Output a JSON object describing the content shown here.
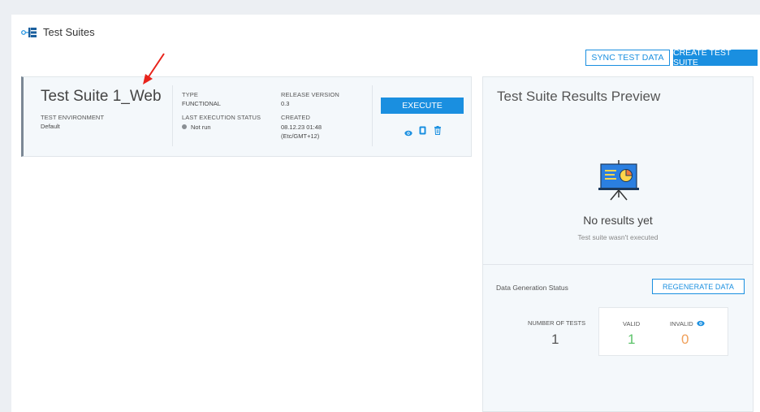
{
  "page": {
    "title": "Test Suites",
    "sync_label": "SYNC TEST DATA",
    "create_label": "CREATE TEST SUITE"
  },
  "suite": {
    "name": "Test Suite 1_Web",
    "env_label": "TEST ENVIRONMENT",
    "env_value": "Default",
    "type_label": "TYPE",
    "type_value": "FUNCTIONAL",
    "status_label": "LAST EXECUTION STATUS",
    "status_value": "Not run",
    "release_label": "RELEASE VERSION",
    "release_value": "0.3",
    "created_label": "CREATED",
    "created_date": "08.12.23 01:48",
    "created_tz": "(Etc/GMT+12)",
    "execute_label": "EXECUTE"
  },
  "preview": {
    "title": "Test Suite Results Preview",
    "empty_title": "No results yet",
    "empty_sub": "Test suite wasn't executed",
    "dgs_label": "Data Generation Status",
    "regen_label": "REGENERATE DATA",
    "num_tests_label": "NUMBER OF TESTS",
    "num_tests_value": "1",
    "valid_label": "VALID",
    "valid_value": "1",
    "invalid_label": "INVALID",
    "invalid_value": "0"
  },
  "colors": {
    "accent": "#1a8fe0",
    "valid": "#5cc36a",
    "invalid": "#f0a05a",
    "annotation_arrow": "#e8231b"
  },
  "icons": [
    "test-suites-icon",
    "view-icon",
    "copy-icon",
    "delete-icon",
    "presentation-chart-icon",
    "eye-icon",
    "annotation-arrow"
  ]
}
